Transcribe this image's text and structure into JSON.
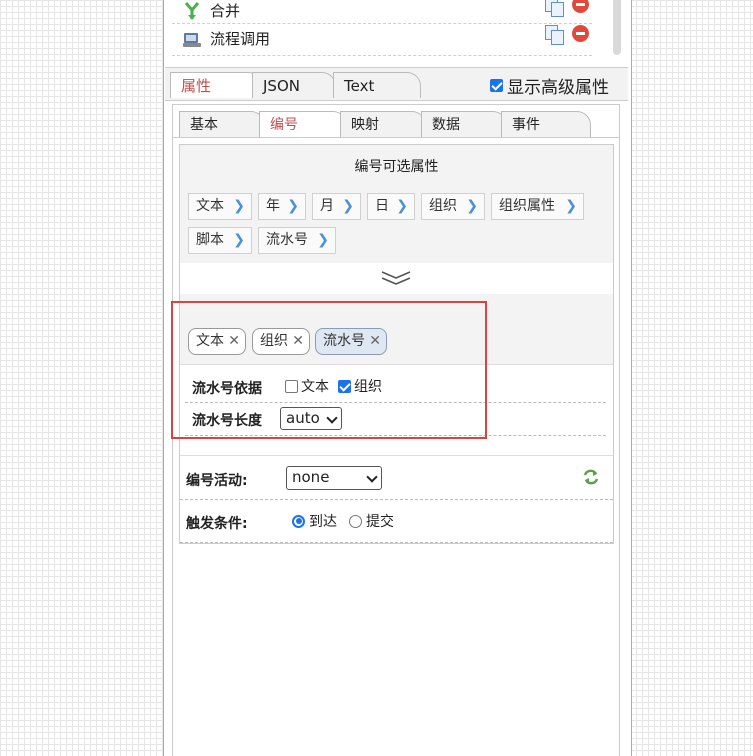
{
  "list": {
    "items": [
      {
        "label": "合并",
        "icon": "merge-icon"
      },
      {
        "label": "流程调用",
        "icon": "process-call-icon"
      }
    ]
  },
  "tabs": [
    "属性",
    "JSON",
    "Text"
  ],
  "advanced_label": "显示高级属性",
  "advanced_checked": true,
  "subtabs": [
    "基本",
    "编号",
    "映射",
    "数据",
    "事件"
  ],
  "options_title": "编号可选属性",
  "options": [
    "文本",
    "年",
    "月",
    "日",
    "组织",
    "组织属性",
    "脚本",
    "流水号"
  ],
  "selected": [
    "文本",
    "组织",
    "流水号"
  ],
  "serial_basis": {
    "label": "流水号依据",
    "options": [
      {
        "label": "文本",
        "checked": false
      },
      {
        "label": "组织",
        "checked": true
      }
    ]
  },
  "serial_length": {
    "label": "流水号长度",
    "value": "auto"
  },
  "number_activity": {
    "label": "编号活动:",
    "value": "none"
  },
  "trigger": {
    "label": "触发条件:",
    "options": [
      {
        "label": "到达",
        "checked": true
      },
      {
        "label": "提交",
        "checked": false
      }
    ]
  },
  "colors": {
    "accent": "#c0504d",
    "highlight_border": "#e04040",
    "link": "#4a90d9"
  }
}
